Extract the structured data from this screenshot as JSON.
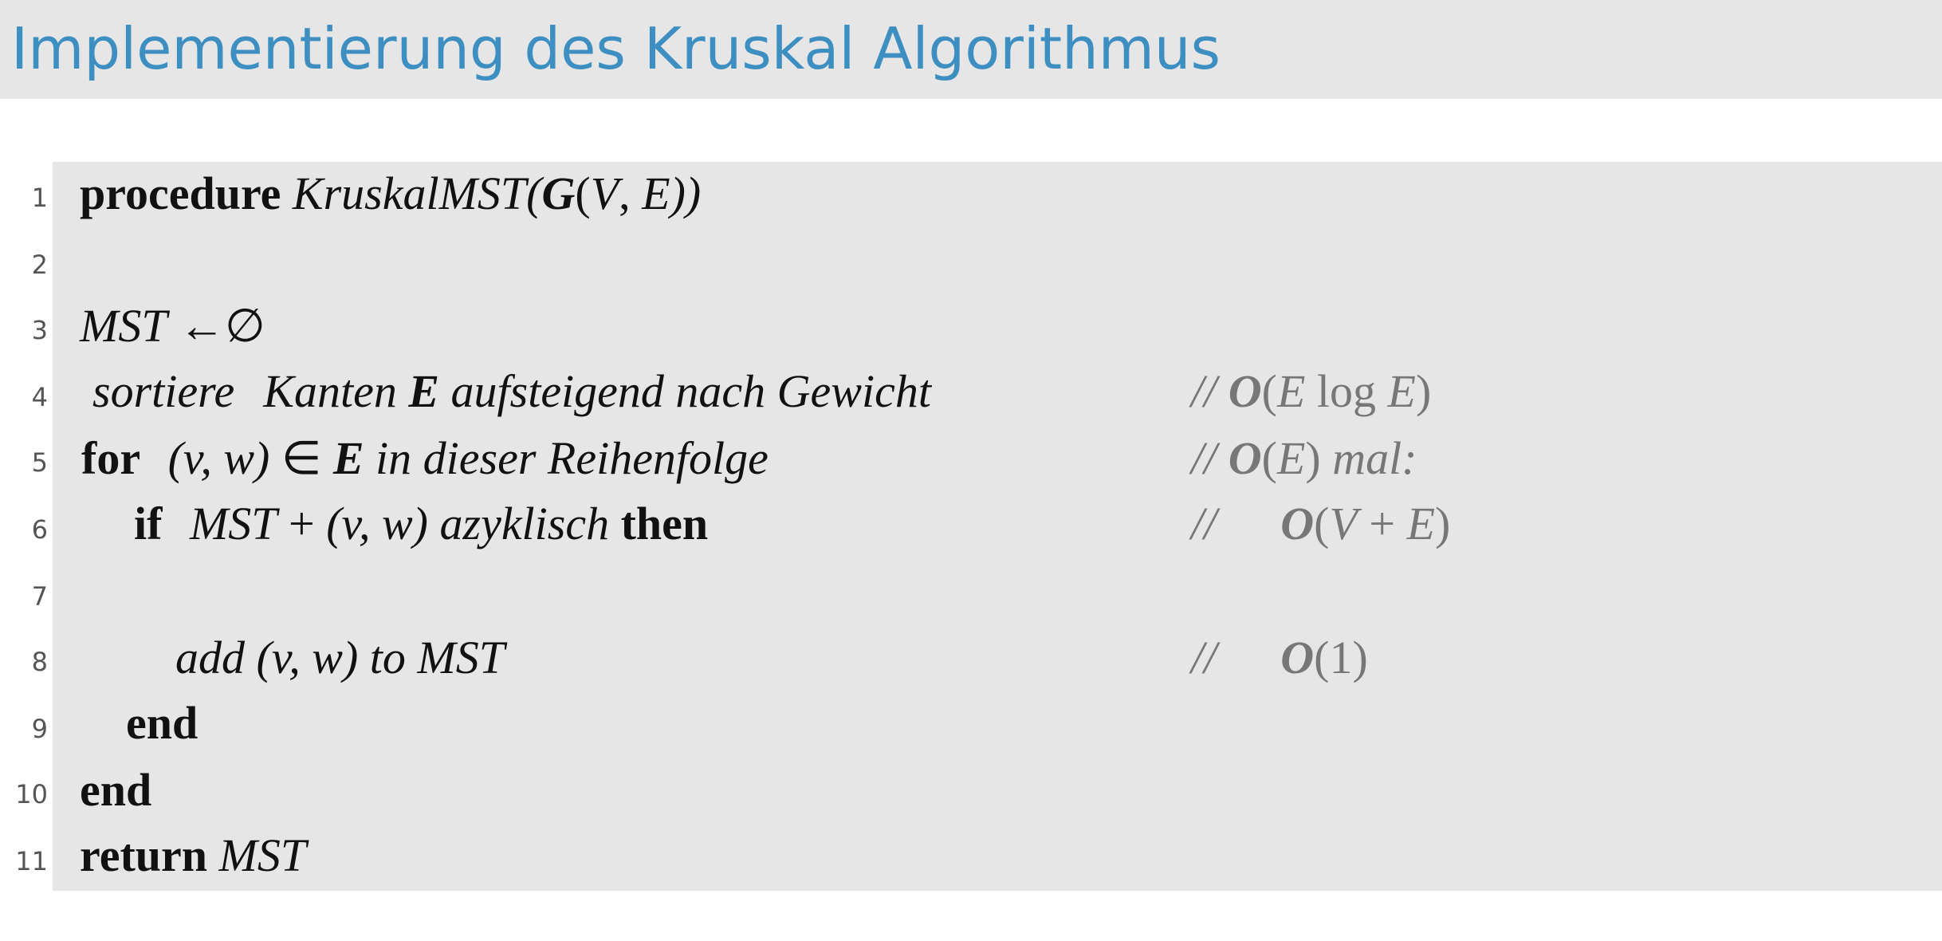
{
  "slide": {
    "title": "Implementierung des Kruskal Algorithmus"
  },
  "code": {
    "line_numbers": [
      "1",
      "2",
      "3",
      "4",
      "5",
      "6",
      "7",
      "8",
      "9",
      "10",
      "11"
    ],
    "line1": {
      "keyword": "procedure",
      "name": "KruskalMST(",
      "graph": "G",
      "open": "(",
      "v": "V",
      "comma": ", ",
      "e": "E",
      "close": "))"
    },
    "line3": {
      "mst": "MST",
      "arrow": "←",
      "empty": "∅"
    },
    "line4": {
      "sortiere": "sortiere",
      "kanten": "Kanten",
      "e": "E",
      "rest": "aufsteigend nach Gewicht"
    },
    "line5": {
      "keyword": "for",
      "pair": "(v, w)",
      "in": "∈",
      "e": "E",
      "rest": "in dieser Reihenfolge"
    },
    "line6": {
      "keyword": "if",
      "mst": "MST",
      "plus": "+",
      "pair": "(v, w)",
      "azyklisch": "azyklisch",
      "then": "then"
    },
    "line8": {
      "add": "add",
      "pair": "(v, w)",
      "to": "to MST"
    },
    "line9": {
      "keyword": "end"
    },
    "line10": {
      "keyword": "end"
    },
    "line11": {
      "keyword": "return",
      "mst": "MST"
    }
  },
  "comments": {
    "slashes": "//",
    "c4": {
      "o": "O",
      "open": "(",
      "e1": "E",
      "log": " log ",
      "e2": "E",
      "close": ")"
    },
    "c5": {
      "o": "O",
      "open": "(",
      "e": "E",
      "close": ")",
      "mal": " mal:"
    },
    "c6": {
      "o": "O",
      "open": "(",
      "v": "V",
      "plus": " + ",
      "e": "E",
      "close": ")"
    },
    "c8": {
      "o": "O",
      "open": "(",
      "one": "1",
      "close": ")"
    }
  }
}
